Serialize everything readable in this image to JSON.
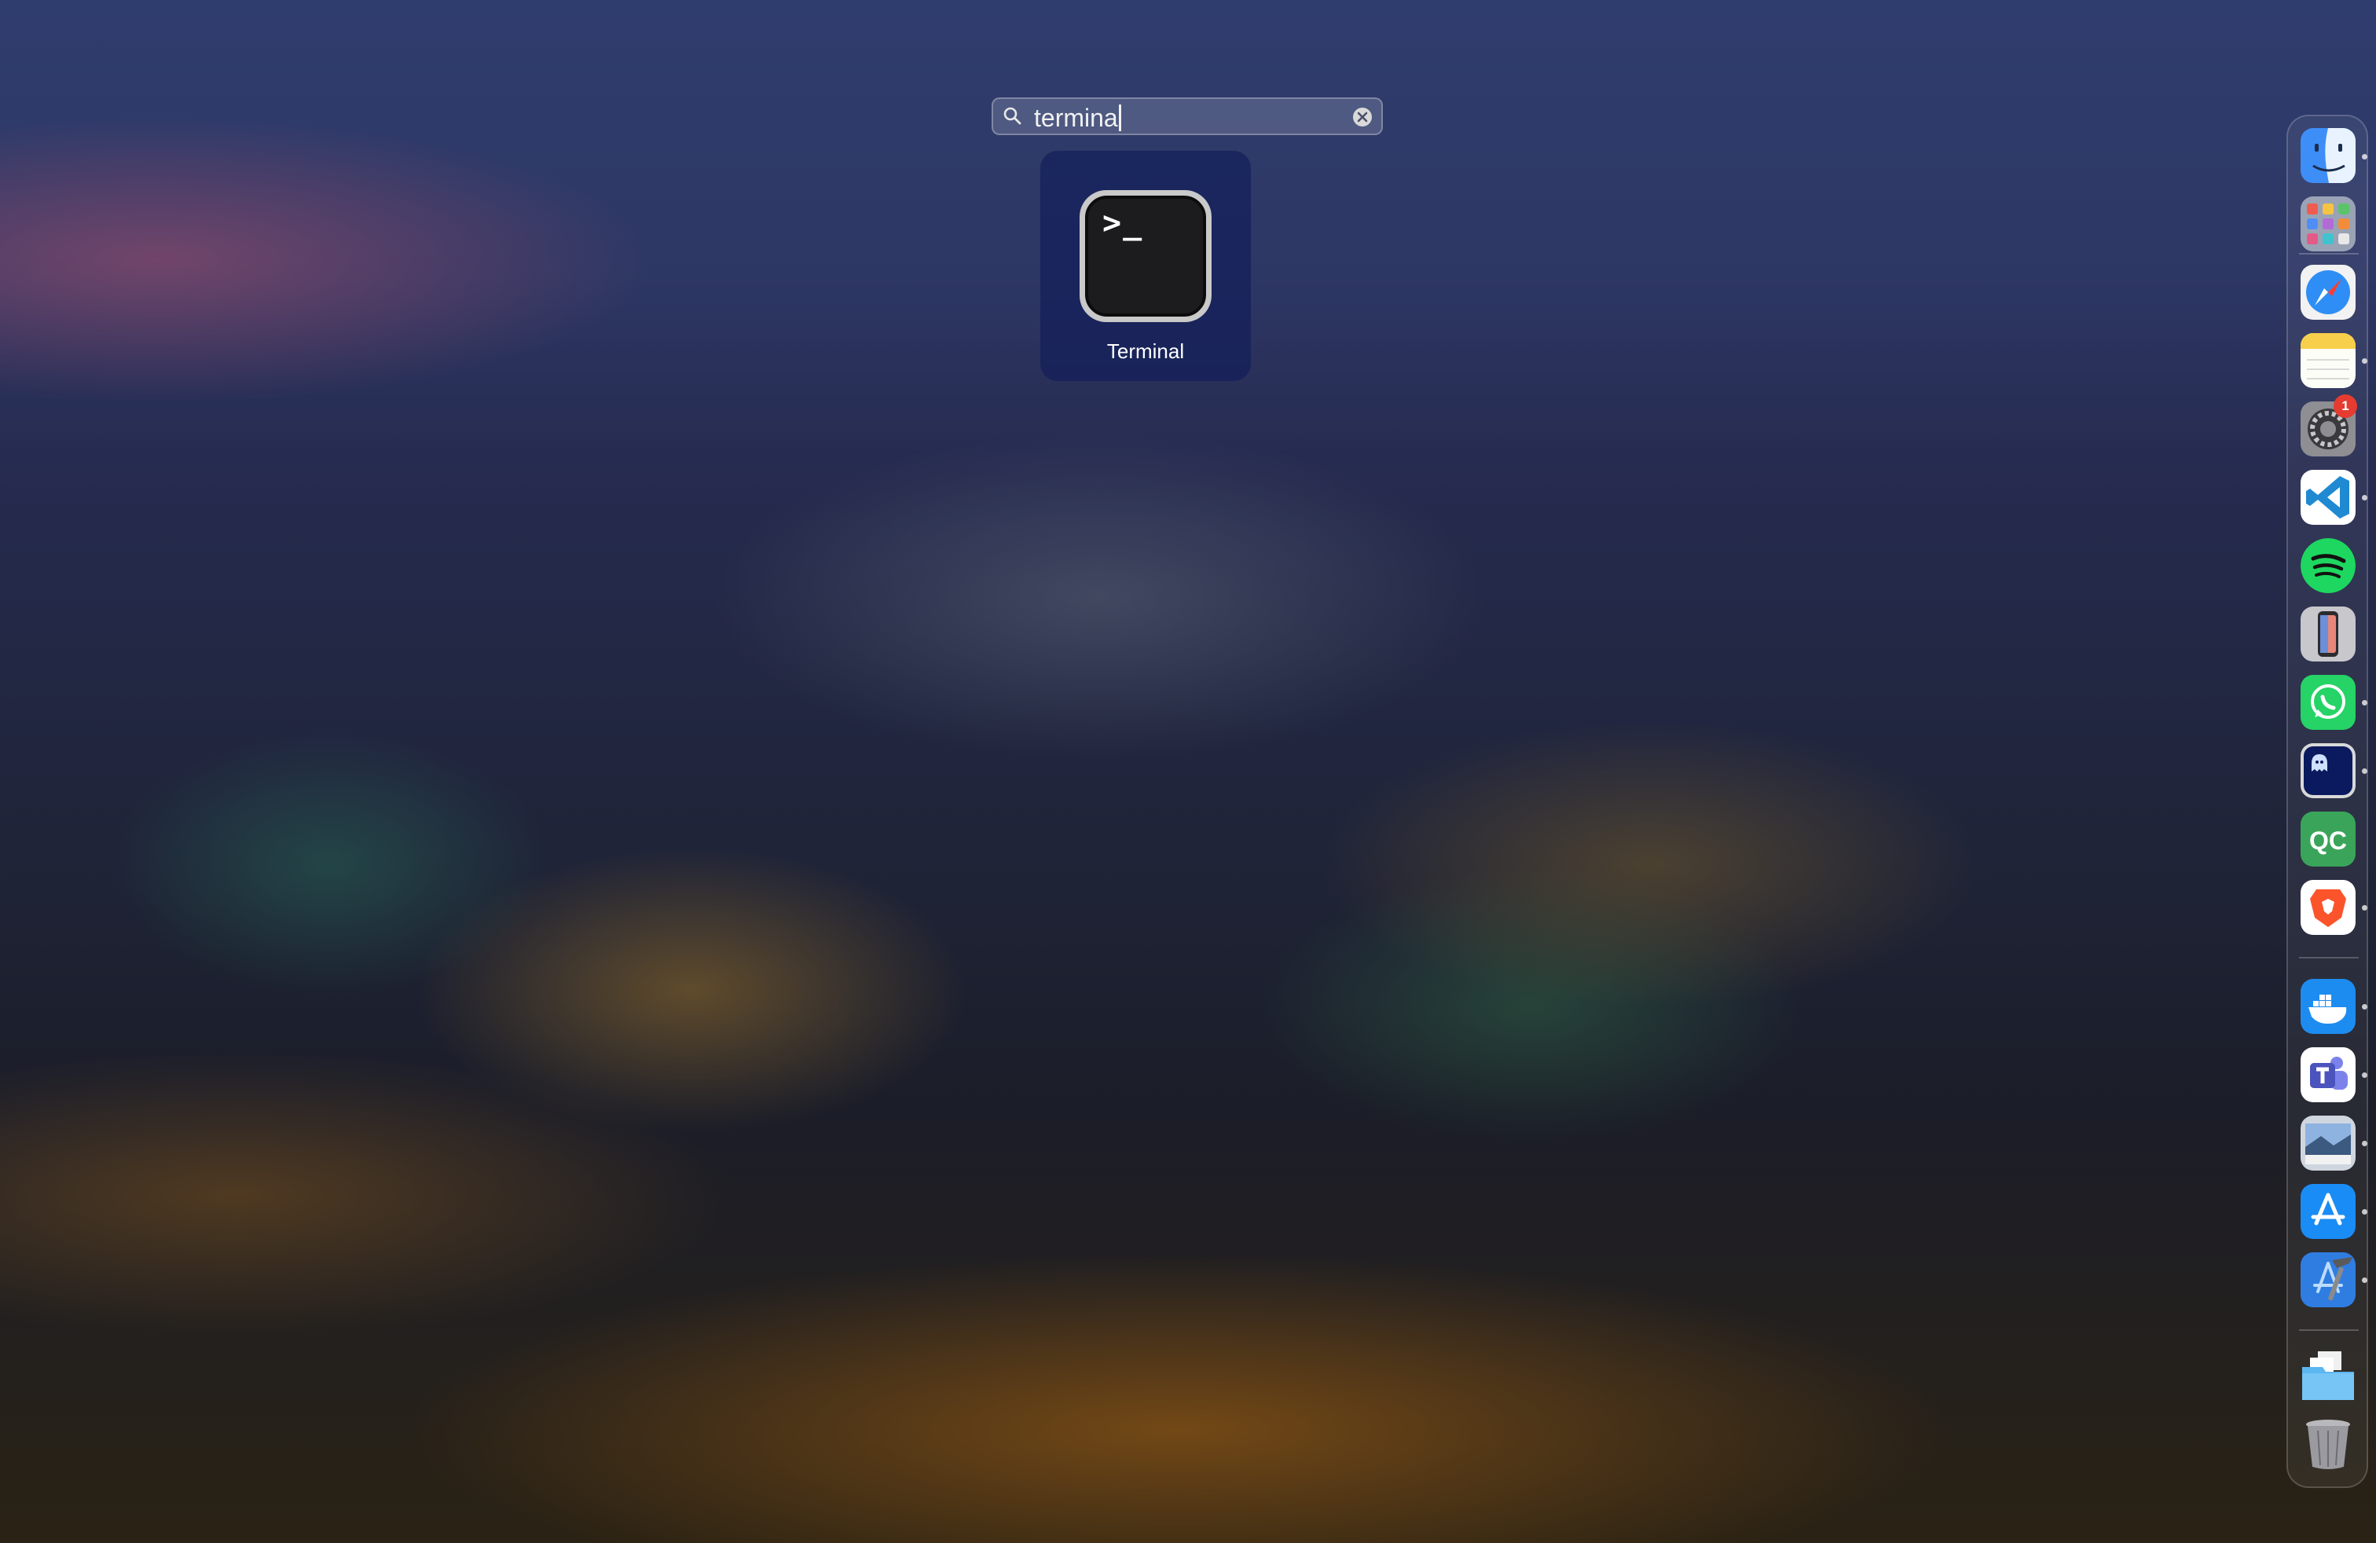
{
  "search": {
    "query": "termina",
    "placeholder": "Search"
  },
  "results": [
    {
      "label": "Terminal",
      "icon": "terminal-icon",
      "prompt": ">_"
    }
  ],
  "dock": {
    "items": [
      {
        "name": "finder",
        "icon": "finder-icon",
        "running": true
      },
      {
        "name": "launchpad",
        "icon": "launchpad-icon",
        "running": false
      },
      {
        "name": "safari",
        "icon": "safari-icon",
        "running": false
      },
      {
        "name": "notes",
        "icon": "notes-icon",
        "running": true
      },
      {
        "name": "system-settings",
        "icon": "gear-icon",
        "running": false,
        "badge": "1"
      },
      {
        "name": "vscode",
        "icon": "vscode-icon",
        "running": true
      },
      {
        "name": "spotify",
        "icon": "spotify-icon",
        "running": false
      },
      {
        "name": "iphone-mirroring",
        "icon": "iphone-icon",
        "running": false
      },
      {
        "name": "whatsapp",
        "icon": "whatsapp-icon",
        "running": true
      },
      {
        "name": "app-dark",
        "icon": "ghost-icon",
        "running": true
      },
      {
        "name": "qc",
        "icon": "qc-icon",
        "label": "QC",
        "running": false
      },
      {
        "name": "brave",
        "icon": "brave-icon",
        "running": true
      },
      {
        "name": "docker",
        "icon": "docker-icon",
        "running": true
      },
      {
        "name": "teams",
        "icon": "teams-icon",
        "running": true
      },
      {
        "name": "preview",
        "icon": "preview-icon",
        "running": true
      },
      {
        "name": "app-store",
        "icon": "app-store-icon",
        "running": true
      },
      {
        "name": "xcode",
        "icon": "xcode-icon",
        "running": true
      },
      {
        "name": "downloads-folder",
        "icon": "folder-icon",
        "running": false
      },
      {
        "name": "trash",
        "icon": "trash-icon",
        "running": false
      }
    ]
  }
}
